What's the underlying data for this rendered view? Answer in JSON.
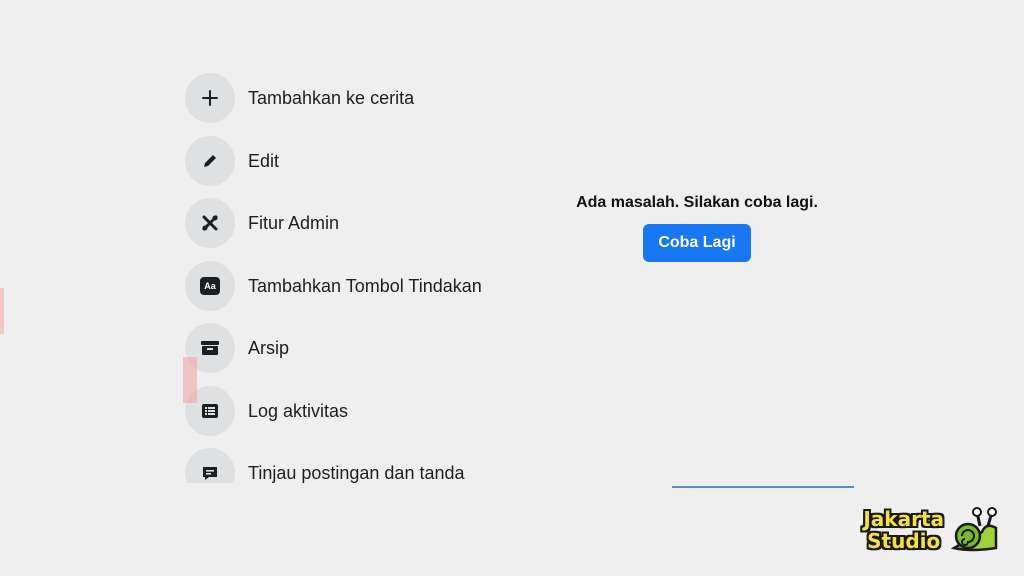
{
  "menu": {
    "items": [
      {
        "label": "Tambahkan ke cerita",
        "icon": "plus-icon"
      },
      {
        "label": "Edit",
        "icon": "pencil-icon"
      },
      {
        "label": "Fitur Admin",
        "icon": "tools-icon"
      },
      {
        "label": "Tambahkan Tombol Tindakan",
        "icon": "action-button-icon",
        "icon_text": "Aa"
      },
      {
        "label": "Arsip",
        "icon": "archive-icon"
      },
      {
        "label": "Log aktivitas",
        "icon": "list-icon"
      },
      {
        "label": "Tinjau postingan dan tanda",
        "icon": "review-icon"
      }
    ]
  },
  "error": {
    "message": "Ada masalah. Silakan coba lagi.",
    "retry_label": "Coba Lagi"
  },
  "watermark": {
    "line1": "Jakarta",
    "line2": "Studio"
  },
  "colors": {
    "background": "#efefef",
    "icon_circle": "#dfe0e2",
    "primary_button": "#1877f2",
    "watermark_text": "#f4e04d"
  }
}
